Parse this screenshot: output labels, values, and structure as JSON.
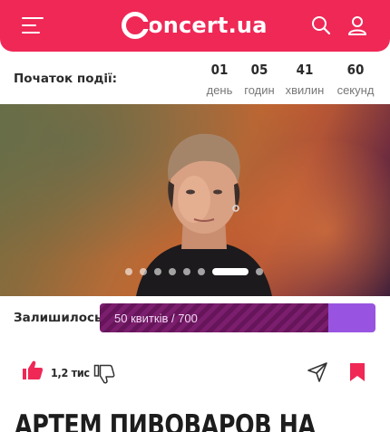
{
  "header": {
    "logo_text": "oncert.ua",
    "accent_color": "#ef2856",
    "icons": [
      "menu-icon",
      "search-icon",
      "user-icon"
    ]
  },
  "countdown": {
    "label": "Початок події:",
    "units": [
      {
        "value": "01",
        "label": "день"
      },
      {
        "value": "05",
        "label": "годин"
      },
      {
        "value": "41",
        "label": "хвилин"
      },
      {
        "value": "60",
        "label": "секунд"
      }
    ]
  },
  "carousel": {
    "slide_count": 8,
    "active_index": 6
  },
  "tickets": {
    "label": "Залишилось",
    "text": "50 квитків / 700",
    "remaining": 50,
    "total": 700,
    "bar_fill_fraction": 0.83,
    "fill_color": "#7c1e6e",
    "track_color": "#9854e0"
  },
  "actions": {
    "like_count": "1,2 тис",
    "icons": [
      "thumbs-up-icon",
      "thumbs-down-icon",
      "share-icon",
      "bookmark-icon"
    ]
  },
  "event": {
    "title": "АРТЕМ ПИВОВАРОВ НА"
  }
}
